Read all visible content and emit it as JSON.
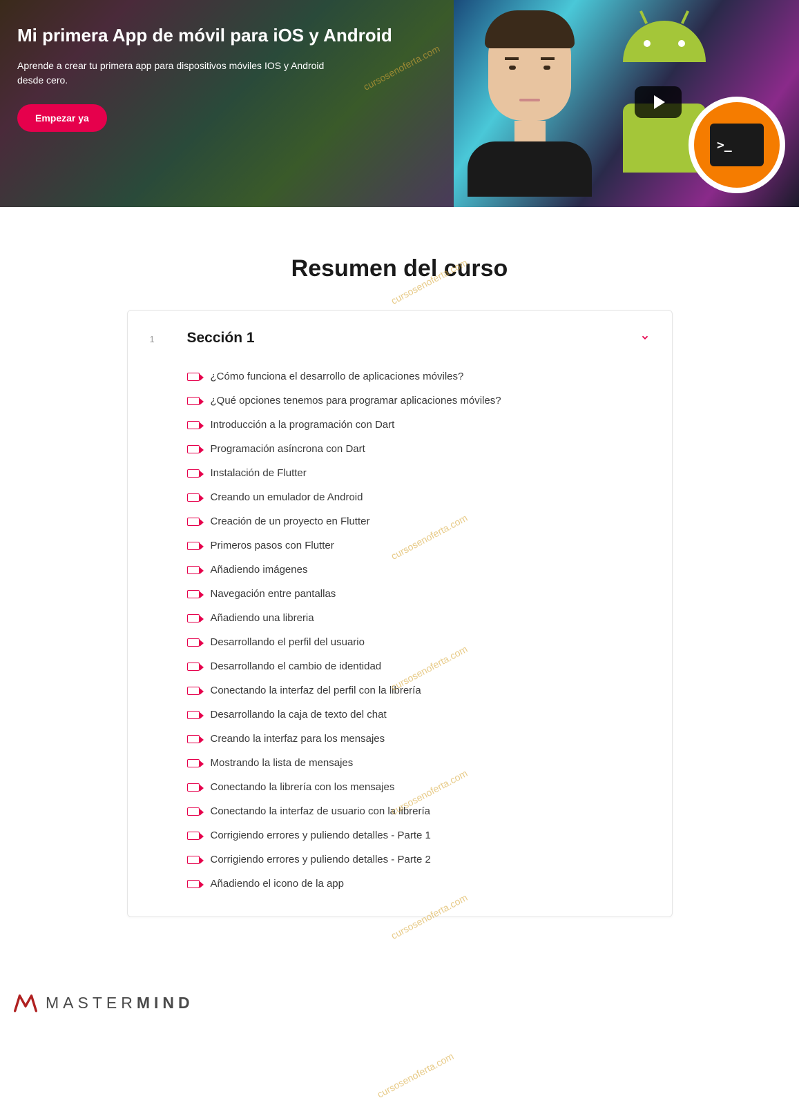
{
  "hero": {
    "title": "Mi primera App de móvil para iOS y Android",
    "subtitle": "Aprende a crear tu primera app para dispositivos móviles IOS y Android desde cero.",
    "cta_label": "Empezar ya",
    "terminal_prompt": ">_"
  },
  "summary": {
    "heading": "Resumen del curso"
  },
  "section": {
    "number": "1",
    "title": "Sección 1",
    "lessons": [
      "¿Cómo funciona el desarrollo de aplicaciones móviles?",
      "¿Qué opciones tenemos para programar aplicaciones móviles?",
      "Introducción a la programación con Dart",
      "Programación asíncrona con Dart",
      "Instalación de Flutter",
      "Creando un emulador de Android",
      "Creación de un proyecto en Flutter",
      "Primeros pasos con Flutter",
      "Añadiendo imágenes",
      "Navegación entre pantallas",
      "Añadiendo una libreria",
      "Desarrollando el perfil del usuario",
      "Desarrollando el cambio de identidad",
      "Conectando la interfaz del perfil con la librería",
      "Desarrollando la caja de texto del chat",
      "Creando la interfaz para los mensajes",
      "Mostrando la lista de mensajes",
      "Conectando la librería con los mensajes",
      "Conectando la interfaz de usuario con la librería",
      "Corrigiendo errores y puliendo detalles - Parte 1",
      "Corrigiendo errores y puliendo detalles - Parte 2",
      "Añadiendo el icono de la app"
    ]
  },
  "footer": {
    "brand_light": "MASTER",
    "brand_bold": "MIND"
  },
  "watermark": "cursosenoferta.com"
}
